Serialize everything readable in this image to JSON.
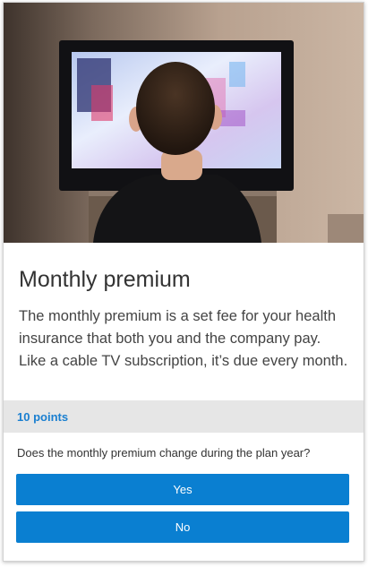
{
  "card": {
    "title": "Monthly premium",
    "description": "The monthly premium is a set fee for your health insurance that both you and the company pay. Like a cable TV subscription, it’s due every month.",
    "points": "10 points",
    "question": "Does the monthly premium change during the plan year?",
    "answers": [
      {
        "label": "Yes"
      },
      {
        "label": "No"
      }
    ]
  },
  "colors": {
    "accent": "#0a7fd1",
    "points_text": "#1a7fd0",
    "points_bar": "#e6e6e6"
  }
}
